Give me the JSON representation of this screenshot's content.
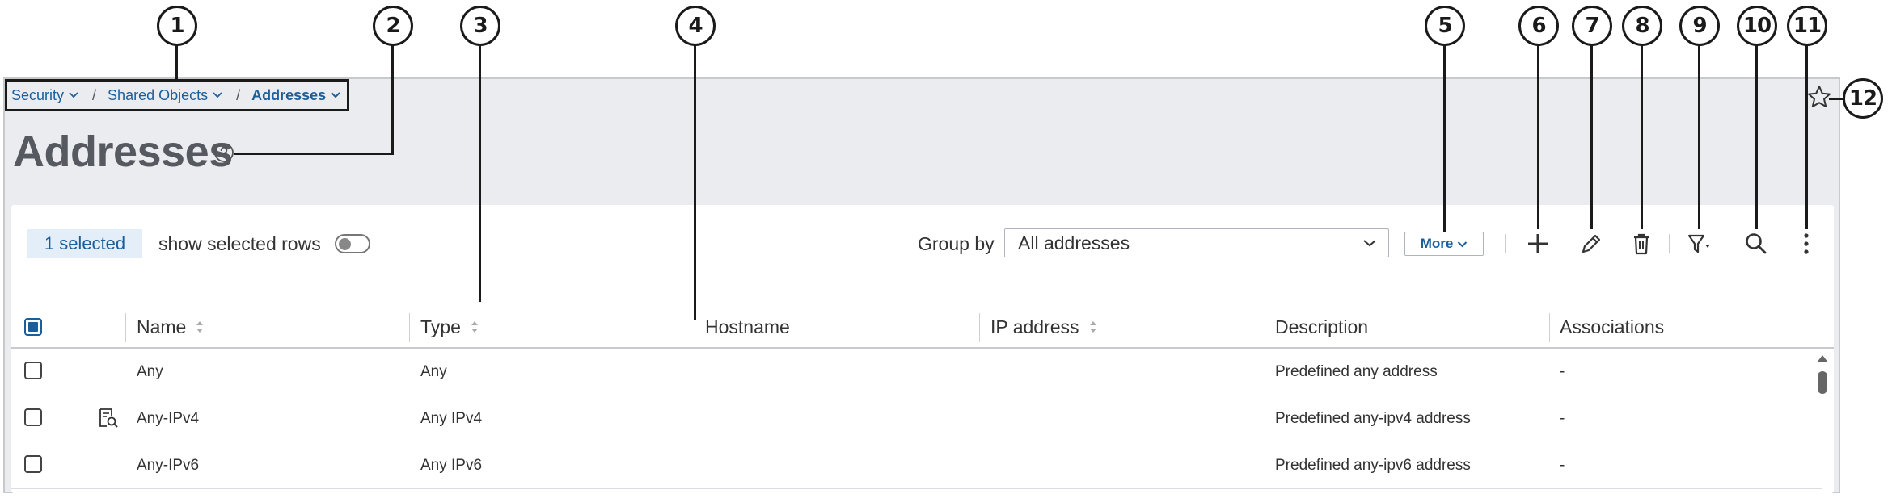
{
  "callouts": [
    "1",
    "2",
    "3",
    "4",
    "5",
    "6",
    "7",
    "8",
    "9",
    "10",
    "11",
    "12"
  ],
  "breadcrumb": {
    "items": [
      {
        "label": "Security"
      },
      {
        "label": "Shared Objects"
      },
      {
        "label": "Addresses"
      }
    ],
    "separator": "/"
  },
  "page": {
    "title": "Addresses"
  },
  "toolbar": {
    "selected_count": "1 selected",
    "show_selected_label": "show selected rows",
    "show_selected_on": false,
    "group_by_label": "Group by",
    "group_by_value": "All addresses",
    "more_label": "More"
  },
  "icons": {
    "help": "help-circle-icon",
    "favorite": "star-icon",
    "add": "plus-icon",
    "edit": "pencil-icon",
    "delete": "trash-icon",
    "filter": "filter-icon",
    "search": "search-icon",
    "more_actions": "vertical-ellipsis-icon",
    "row_detail": "detail-search-icon"
  },
  "table": {
    "columns": [
      "Name",
      "Type",
      "Hostname",
      "IP address",
      "Description",
      "Associations"
    ],
    "rows": [
      {
        "name": "Any",
        "type": "Any",
        "hostname": "",
        "ip": "",
        "description": "Predefined any address",
        "associations": "-",
        "has_icon": false,
        "checked": false
      },
      {
        "name": "Any-IPv4",
        "type": "Any IPv4",
        "hostname": "",
        "ip": "",
        "description": "Predefined any-ipv4 address",
        "associations": "-",
        "has_icon": true,
        "checked": false
      },
      {
        "name": "Any-IPv6",
        "type": "Any IPv6",
        "hostname": "",
        "ip": "",
        "description": "Predefined any-ipv6 address",
        "associations": "-",
        "has_icon": false,
        "checked": false
      }
    ]
  },
  "colors": {
    "accent": "#1b5e9c",
    "header_bg": "#ebecef",
    "chip_bg": "#e3eef9",
    "title": "#565a60"
  }
}
